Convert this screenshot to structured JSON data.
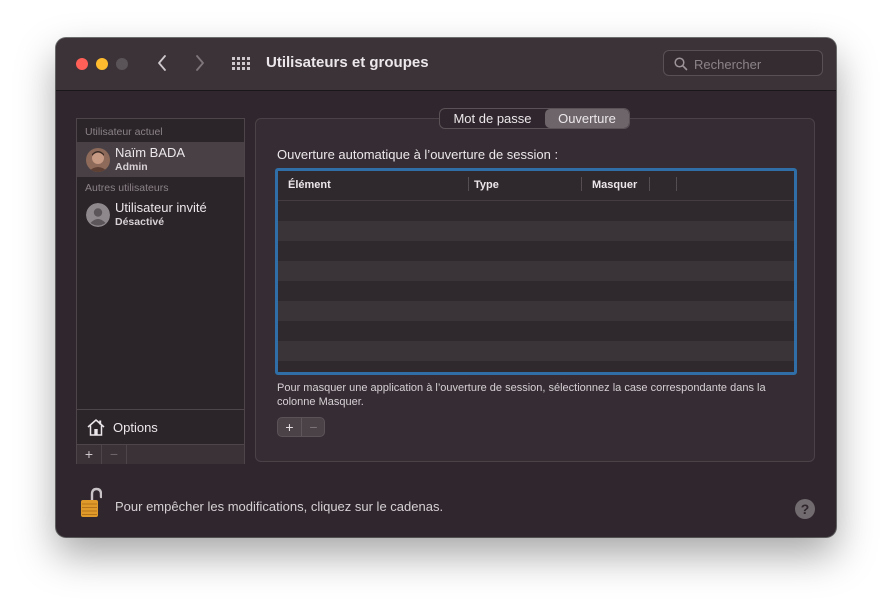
{
  "window": {
    "title": "Utilisateurs et groupes",
    "search_placeholder": "Rechercher"
  },
  "sidebar": {
    "current_section": "Utilisateur actuel",
    "current_user": {
      "name": "Naïm BADA",
      "role": "Admin"
    },
    "others_section": "Autres utilisateurs",
    "other_users": [
      {
        "name": "Utilisateur invité",
        "status": "Désactivé"
      }
    ],
    "options_label": "Options",
    "add_label": "+",
    "remove_label": "−"
  },
  "tabs": {
    "items": [
      "Mot de passe",
      "Ouverture"
    ],
    "selected": "Ouverture"
  },
  "login_items": {
    "heading": "Ouverture automatique à l’ouverture de session :",
    "columns": [
      "Élément",
      "Type",
      "Masquer"
    ],
    "rows": [],
    "help_text": "Pour masquer une application à l’ouverture de session, sélectionnez la case correspondante dans la colonne Masquer.",
    "add_label": "+",
    "remove_label": "−"
  },
  "footer": {
    "lock_text": "Pour empêcher les modifications, cliquez sur le cadenas.",
    "help_label": "?"
  },
  "colors": {
    "window_bg": "#2f272d",
    "focus_ring": "#2f6ea6",
    "close": "#fe5f57",
    "minimize": "#febc2e"
  }
}
